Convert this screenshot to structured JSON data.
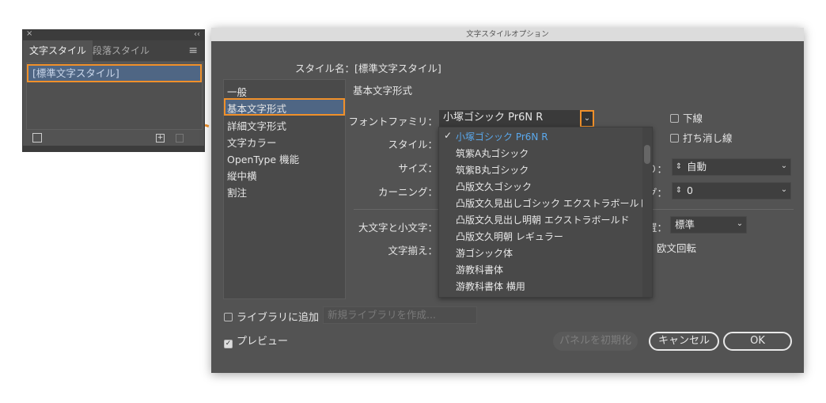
{
  "panel": {
    "close": "×",
    "collapse": "‹‹",
    "tabs": [
      "文字スタイル",
      "段落スタイル"
    ],
    "menu": "≡",
    "styles": [
      "[標準文字スタイル]"
    ]
  },
  "dialog": {
    "title": "文字スタイルオプション",
    "style_name_label": "スタイル名：",
    "style_name": "[標準文字スタイル]",
    "categories": [
      "一般",
      "基本文字形式",
      "詳細文字形式",
      "文字カラー",
      "OpenType 機能",
      "縦中横",
      "割注"
    ],
    "section_title": "基本文字形式",
    "labels": {
      "font_family": "フォントファミリ：",
      "style": "スタイル：",
      "size": "サイズ：",
      "kerning": "カーニング：",
      "case": "大文字と小文字：",
      "align": "文字揃え：",
      "leading_tail": "り：",
      "tracking_tail": "グ：",
      "position_tail": "置：",
      "rotate_tail": "欧文回転"
    },
    "font_family_value": "小塚ゴシック Pr6N R",
    "font_options": [
      "小塚ゴシック Pr6N R",
      "筑紫A丸ゴシック",
      "筑紫B丸ゴシック",
      "凸版文久ゴシック",
      "凸版文久見出しゴシック エクストラボールド",
      "凸版文久見出し明朝 エクストラボールド",
      "凸版文久明朝 レギュラー",
      "游ゴシック体",
      "游教科書体",
      "游教科書体 横用"
    ],
    "selected_check": "✓",
    "underline": "下線",
    "strikethrough": "打ち消し線",
    "leading_value": "自動",
    "tracking_value": "0",
    "position_value": "標準",
    "add_library": "ライブラリに追加",
    "library_placeholder": "新規ライブラリを作成...",
    "preview": "プレビュー",
    "reset": "パネルを初期化",
    "cancel": "キャンセル",
    "ok": "OK"
  },
  "colors": {
    "accent": "#f0902a",
    "selection": "#4f6684",
    "selected_text": "#5aa8ec"
  }
}
